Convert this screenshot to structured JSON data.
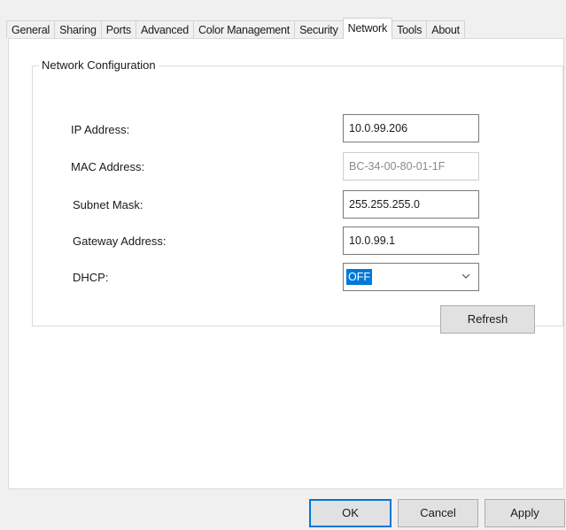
{
  "tabs": [
    {
      "label": "General"
    },
    {
      "label": "Sharing"
    },
    {
      "label": "Ports"
    },
    {
      "label": "Advanced"
    },
    {
      "label": "Color Management"
    },
    {
      "label": "Security"
    },
    {
      "label": "Network"
    },
    {
      "label": "Tools"
    },
    {
      "label": "About"
    }
  ],
  "active_tab": "Network",
  "network": {
    "group_title": "Network Configuration",
    "ip_label": "IP Address:",
    "ip_value": "10.0.99.206",
    "mac_label": "MAC Address:",
    "mac_value": "BC-34-00-80-01-1F",
    "subnet_label": "Subnet Mask:",
    "subnet_value": "255.255.255.0",
    "gateway_label": "Gateway Address:",
    "gateway_value": "10.0.99.1",
    "dhcp_label": "DHCP:",
    "dhcp_value": "OFF",
    "refresh_label": "Refresh"
  },
  "footer": {
    "ok_label": "OK",
    "cancel_label": "Cancel",
    "apply_label": "Apply"
  },
  "colors": {
    "accent": "#0078d7",
    "background": "#f0f0f0",
    "panel": "#ffffff"
  },
  "icons": {
    "dropdown": "chevron-down-icon"
  }
}
